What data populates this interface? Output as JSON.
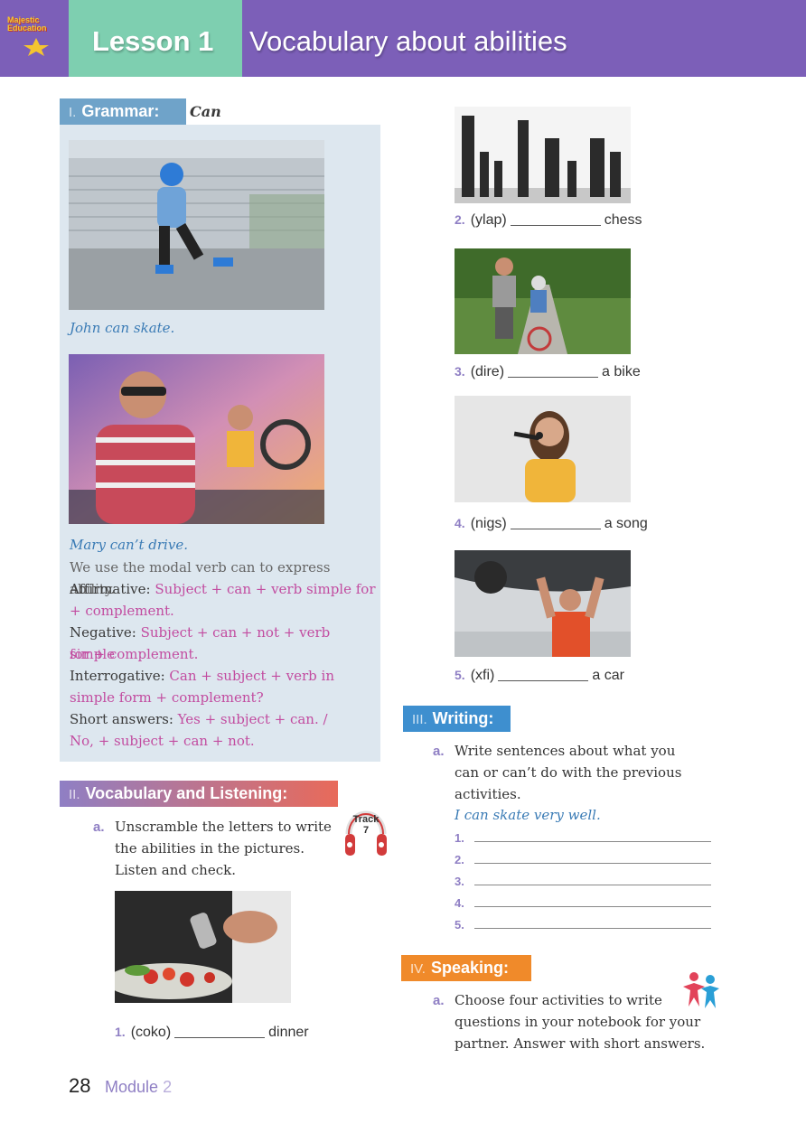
{
  "header": {
    "logo_line1": "Majestic",
    "logo_line2": "Education",
    "lesson_label": "Lesson 1",
    "lesson_title": "Vocabulary about abilities"
  },
  "grammar": {
    "num": "I.",
    "heading": "Grammar:",
    "heading_word": "Can",
    "caption1": "John can skate.",
    "caption2": "Mary can’t drive.",
    "explain": "We use the modal verb can to express ability.",
    "affirmative_label": "Affirmative:",
    "affirmative_line1": "Subject + can + verb simple for",
    "affirmative_line2": "+ complement.",
    "negative_label": "Negative:",
    "negative_line1": "Subject + can + not + verb simple",
    "negative_line2": "for + complement.",
    "interrogative_label": "Interrogative:",
    "interrogative_line1": "Can + subject + verb in",
    "interrogative_line2": "simple form + complement?",
    "short_label": "Short answers:",
    "short_line1": "Yes + subject + can. /",
    "short_line2": "No, + subject + can + not."
  },
  "vocab": {
    "num": "II.",
    "heading": "Vocabulary and Listening:",
    "track_label": "Track",
    "track_num": "7",
    "a_letter": "a.",
    "a_line1": "Unscramble the letters to write",
    "a_line2": "the abilities in the pictures.",
    "a_line3": "Listen and check.",
    "items": [
      {
        "n": "1.",
        "clue": "(coko)",
        "rest": "dinner"
      },
      {
        "n": "2.",
        "clue": "(ylap)",
        "rest": "chess"
      },
      {
        "n": "3.",
        "clue": "(dire)",
        "rest": "a bike"
      },
      {
        "n": "4.",
        "clue": "(nigs)",
        "rest": "a song"
      },
      {
        "n": "5.",
        "clue": "(xfi)",
        "rest": "a car"
      }
    ]
  },
  "writing": {
    "num": "III.",
    "heading": "Writing:",
    "a_letter": "a.",
    "a_line1": "Write sentences about what you",
    "a_line2": "can or can’t do with the previous",
    "a_line3": "activities.",
    "example": "I can skate very well.",
    "lines": [
      "1.",
      "2.",
      "3.",
      "4.",
      "5."
    ]
  },
  "speaking": {
    "num": "IV.",
    "heading": "Speaking:",
    "a_letter": "a.",
    "a_line1": "Choose four activities to write",
    "a_line2": "questions in your notebook for your",
    "a_line3": "partner. Answer with short answers."
  },
  "footer": {
    "page": "28",
    "module_label": "Module",
    "module_num": "2"
  },
  "colors": {
    "header": "#7c5fb8",
    "lesson_box": "#7ecfb0",
    "grammar": "#6fa3c9",
    "writing": "#3e8fcf",
    "speaking": "#f08a2a",
    "pink_text": "#c24ca0",
    "caption": "#3a7bb5"
  }
}
